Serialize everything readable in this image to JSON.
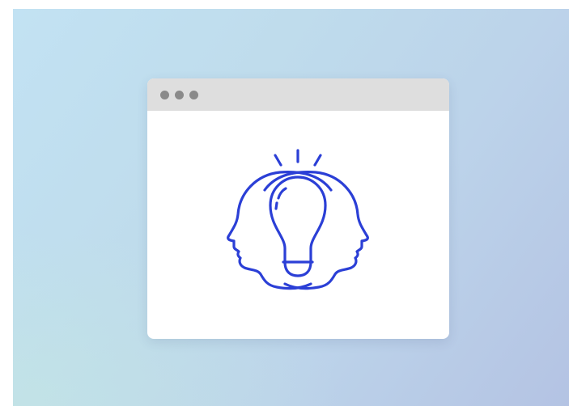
{
  "window": {
    "controls": [
      "window-dot",
      "window-dot",
      "window-dot"
    ]
  },
  "illustration": {
    "icon": "two-heads-lightbulb-icon",
    "stroke_color": "#2b3fd6"
  },
  "colors": {
    "background_start": "#c2e2f3",
    "background_end": "#b4c3e3",
    "titlebar": "#dedede",
    "window_dot": "#8a8a8a",
    "window_body": "#ffffff"
  }
}
